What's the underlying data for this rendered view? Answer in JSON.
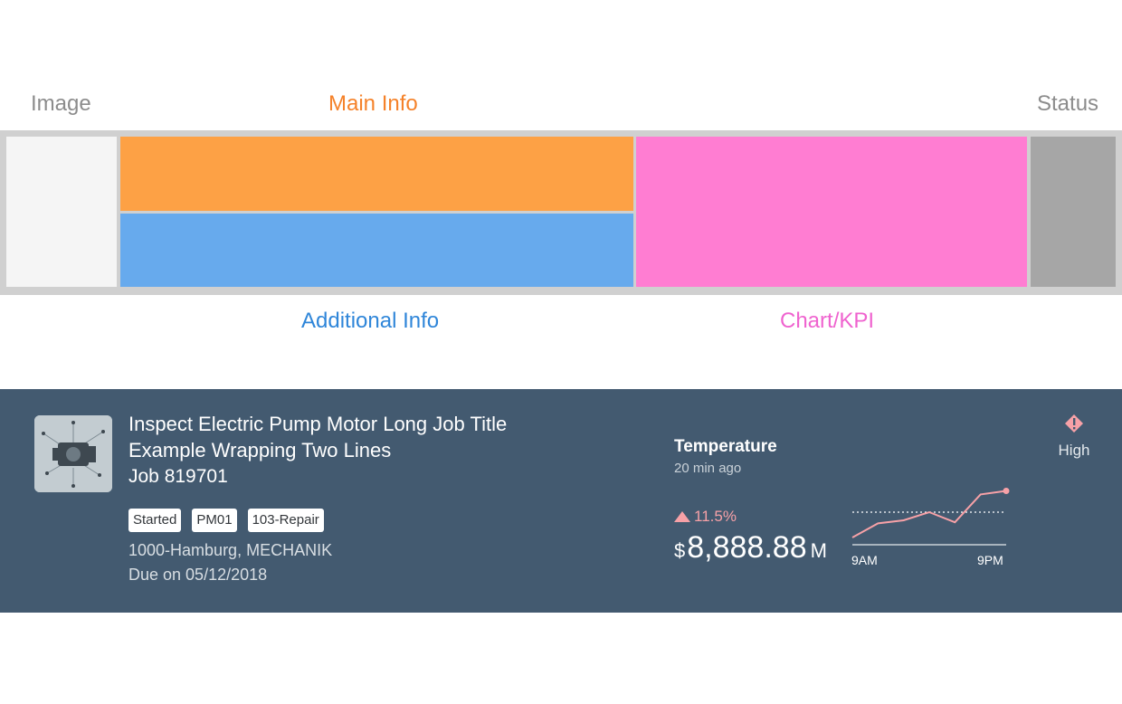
{
  "diagram": {
    "image_label": "Image",
    "main_info_label": "Main Info",
    "status_label": "Status",
    "additional_info_label": "Additional Info",
    "chart_kpi_label": "Chart/KPI",
    "colors": {
      "image": "#f5f5f5",
      "main_info": "#fda145",
      "additional_info": "#67aaed",
      "chart_kpi": "#ff7dd2",
      "status": "#a6a6a6"
    }
  },
  "card": {
    "image_icon": "pump-motor-image",
    "title": "Inspect Electric Pump Motor Long Job Title Example Wrapping Two Lines",
    "subtitle": "Job 819701",
    "tags": [
      "Started",
      "PM01",
      "103-Repair"
    ],
    "location": "1000-Hamburg, MECHANIK",
    "due": "Due on 05/12/2018",
    "kpi": {
      "title": "Temperature",
      "timestamp": "20 min ago",
      "trend_direction": "up",
      "trend_value": "11.5%",
      "currency": "$",
      "value": "8,888.88",
      "scale": "M"
    },
    "status": {
      "icon": "warning-diamond-icon",
      "label": "High",
      "color": "#f7a1a7"
    }
  },
  "chart_data": {
    "type": "line",
    "x_labels": [
      "9AM",
      "9PM"
    ],
    "series": [
      {
        "values": [
          0.0,
          0.28,
          0.34,
          0.5,
          0.3,
          0.85,
          0.92
        ]
      }
    ],
    "reference_line": 0.5,
    "ylim": [
      0,
      1
    ],
    "line_color": "#f7a1a7"
  }
}
